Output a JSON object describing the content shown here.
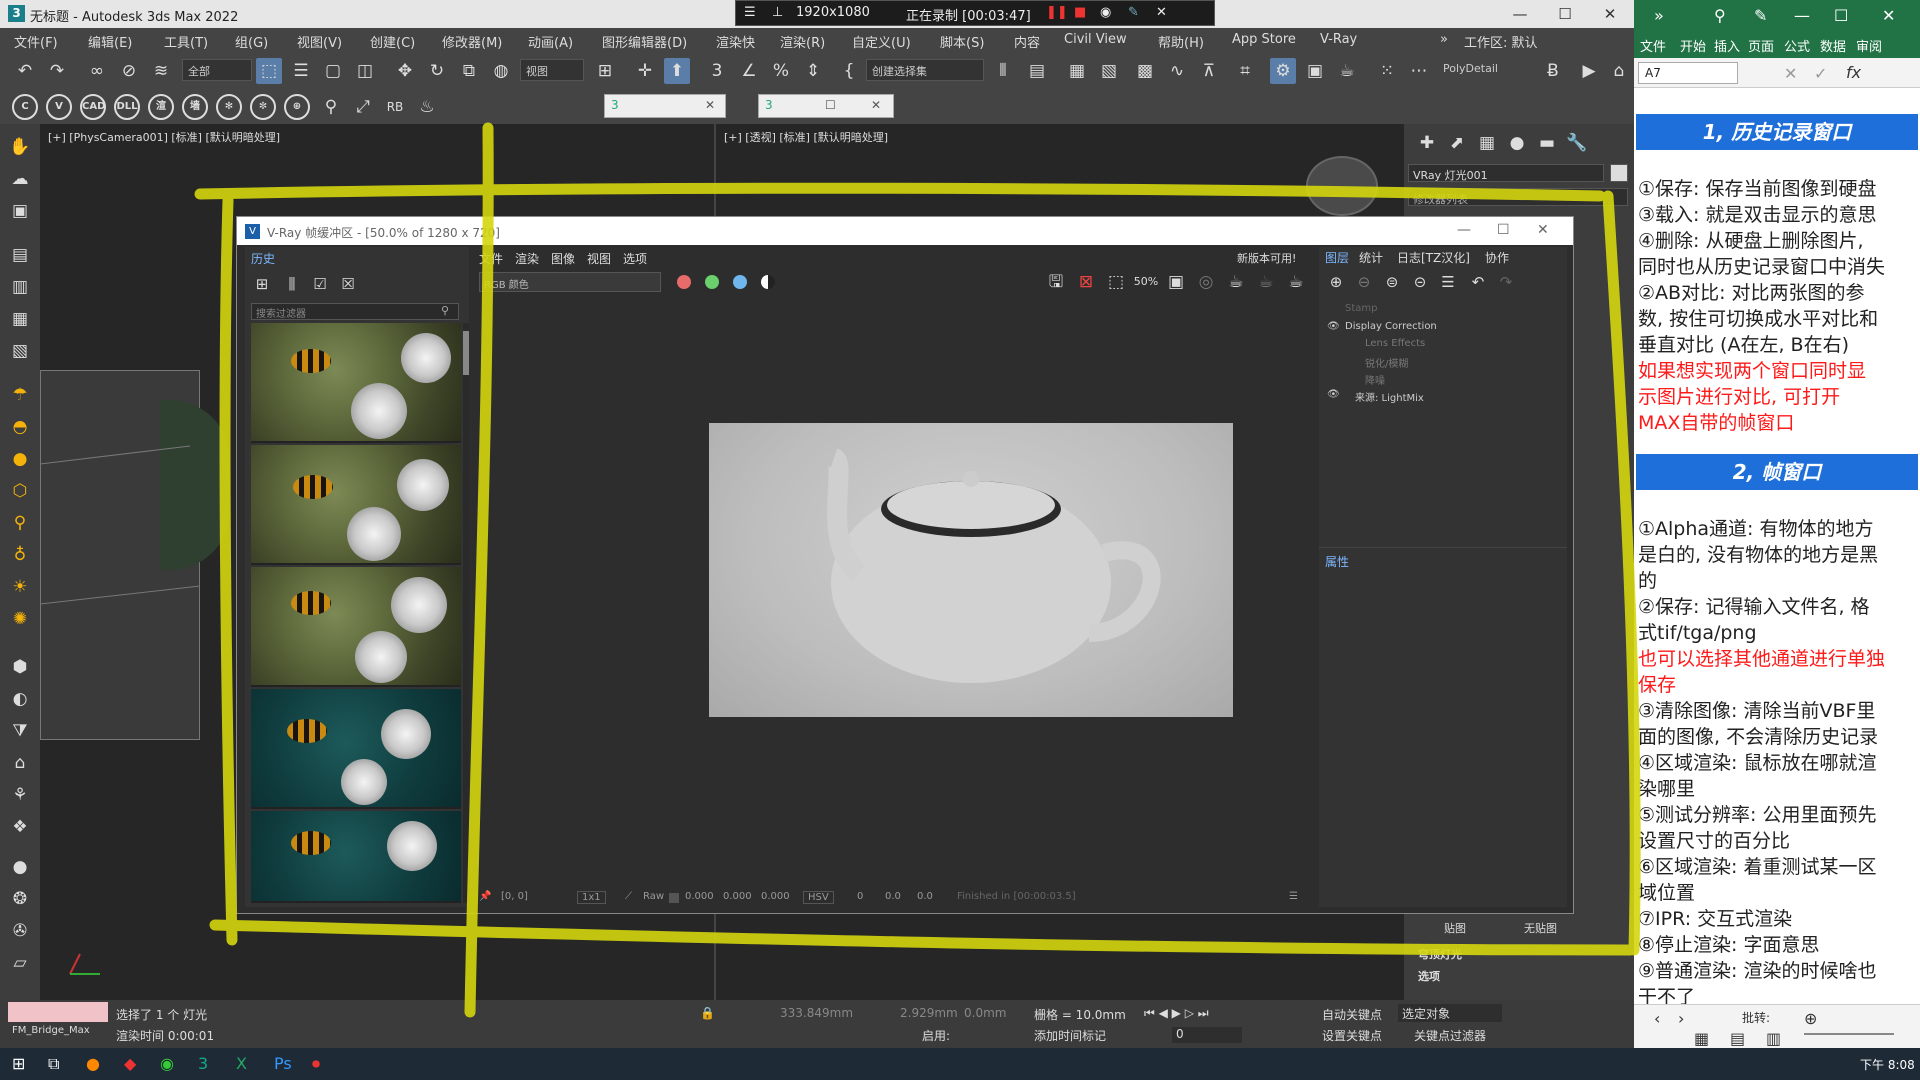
{
  "max": {
    "title": "无标题 - Autodesk 3ds Max 2022",
    "recording": {
      "resolution": "1920x1080",
      "status": "正在录制 [00:03:47]"
    },
    "menu": [
      "文件(F)",
      "编辑(E)",
      "工具(T)",
      "组(G)",
      "视图(V)",
      "创建(C)",
      "修改器(M)",
      "动画(A)",
      "图形编辑器(D)",
      "渲染(R)",
      "自定义(U)",
      "脚本(S)",
      "内容",
      "Civil View",
      "帮助(H)",
      "App Store",
      "V-Ray"
    ],
    "menu_extra": "渲染快",
    "workspace": "工作区: 默认",
    "toolbar": {
      "filter_all": "全部",
      "view_select": "视图",
      "create_selection": "创建选择集",
      "poly_detail": "PolyDetail"
    },
    "vp1_label": "[+] [PhysCamera001] [标准] [默认明暗处理]",
    "vp2_label": "[+] [透视] [标准] [默认明暗处理]",
    "cmd": {
      "object": "VRay 灯光001",
      "modifier_list": "修改器列表",
      "rollout_ceiling": "穹顶灯光",
      "rollout_opts": "选项",
      "chk1": "贴图",
      "chk2": "无贴图"
    },
    "status": {
      "selected": "选择了 1 个 灯光",
      "render_time": "渲染时间  0:00:01",
      "x": "333.849mm",
      "y": "2.929mm",
      "z": "0.0mm",
      "grid": "栅格 = 10.0mm",
      "autokey": "自动关键点",
      "setkey": "设置关键点",
      "selected_obj": "选定对象",
      "keyfilter": "关键点过滤器",
      "enable": "启用:",
      "add_time_tag": "添加时间标记",
      "frame": "0",
      "script": "FM_Bridge_Max"
    },
    "taskbar_clock": "下午 8:08"
  },
  "vfb": {
    "title": "V-Ray 帧缓冲区 - [50.0% of 1280 x 720]",
    "history_tab": "历史",
    "search_placeholder": "搜索过滤器",
    "menu": [
      "文件",
      "渲染",
      "图像",
      "视图",
      "选项"
    ],
    "update_note": "新版本可用!",
    "channel": "RGB 颜色",
    "coords": "[0, 0]",
    "zoom": "1x1",
    "raw_label": "Raw",
    "rgb_vals": [
      "0.000",
      "0.000",
      "0.000"
    ],
    "color_mode": "HSV",
    "hsv_vals": [
      "0",
      "0.0",
      "0.0"
    ],
    "finished": "Finished in [00:00:03.5]",
    "layer_tabs": [
      "图层",
      "统计",
      "日志[TZ汉化]",
      "协作"
    ],
    "layers": [
      "Stamp",
      "Display Correction",
      "Lens Effects",
      "锐化/模糊",
      "降噪",
      "来源: LightMix"
    ],
    "properties": "属性"
  },
  "excel": {
    "menu": [
      "文件",
      "开始",
      "插入",
      "页面",
      "公式",
      "数据",
      "审阅"
    ],
    "cell": "A7",
    "section1": "1, 历史记录窗口",
    "lines1": [
      {
        "t": "①保存: 保存当前图像到硬盘",
        "red": false
      },
      {
        "t": "③载入: 就是双击显示的意思",
        "red": false
      },
      {
        "t": "④删除: 从硬盘上删除图片,",
        "red": false
      },
      {
        "t": "同时也从历史记录窗口中消失",
        "red": false
      },
      {
        "t": "②AB对比: 对比两张图的参",
        "red": false
      },
      {
        "t": "数, 按住可切换成水平对比和",
        "red": false
      },
      {
        "t": "垂直对比 (A在左, B在右)",
        "red": false
      },
      {
        "t": "如果想实现两个窗口同时显",
        "red": true
      },
      {
        "t": "示图片进行对比, 可打开",
        "red": true
      },
      {
        "t": "MAX自带的帧窗口",
        "red": true
      }
    ],
    "section2": "2, 帧窗口",
    "lines2": [
      {
        "t": "①Alpha通道: 有物体的地方",
        "red": false
      },
      {
        "t": "是白的, 没有物体的地方是黑",
        "red": false
      },
      {
        "t": "的",
        "red": false
      },
      {
        "t": "②保存: 记得输入文件名, 格",
        "red": false
      },
      {
        "t": "式tif/tga/png",
        "red": false
      },
      {
        "t": "也可以选择其他通道进行单独",
        "red": true
      },
      {
        "t": "保存",
        "red": true
      },
      {
        "t": "③清除图像: 清除当前VBF里",
        "red": false
      },
      {
        "t": "面的图像, 不会清除历史记录",
        "red": false
      },
      {
        "t": "④区域渲染: 鼠标放在哪就渲",
        "red": false
      },
      {
        "t": "染哪里",
        "red": false
      },
      {
        "t": "⑤测试分辨率: 公用里面预先",
        "red": false
      },
      {
        "t": "设置尺寸的百分比",
        "red": false
      },
      {
        "t": "⑥区域渲染: 着重测试某一区",
        "red": false
      },
      {
        "t": "域位置",
        "red": false
      },
      {
        "t": "⑦IPR: 交互式渲染",
        "red": false
      },
      {
        "t": "⑧停止渲染: 字面意思",
        "red": false
      },
      {
        "t": "⑨普通渲染: 渲染的时候啥也",
        "red": false
      },
      {
        "t": "干不了",
        "red": false
      }
    ],
    "bottom_label": "批转:"
  },
  "colors": {
    "annotation": "#d4d60e",
    "accent": "#1e6fd9",
    "red_text": "#ff1a1a"
  }
}
